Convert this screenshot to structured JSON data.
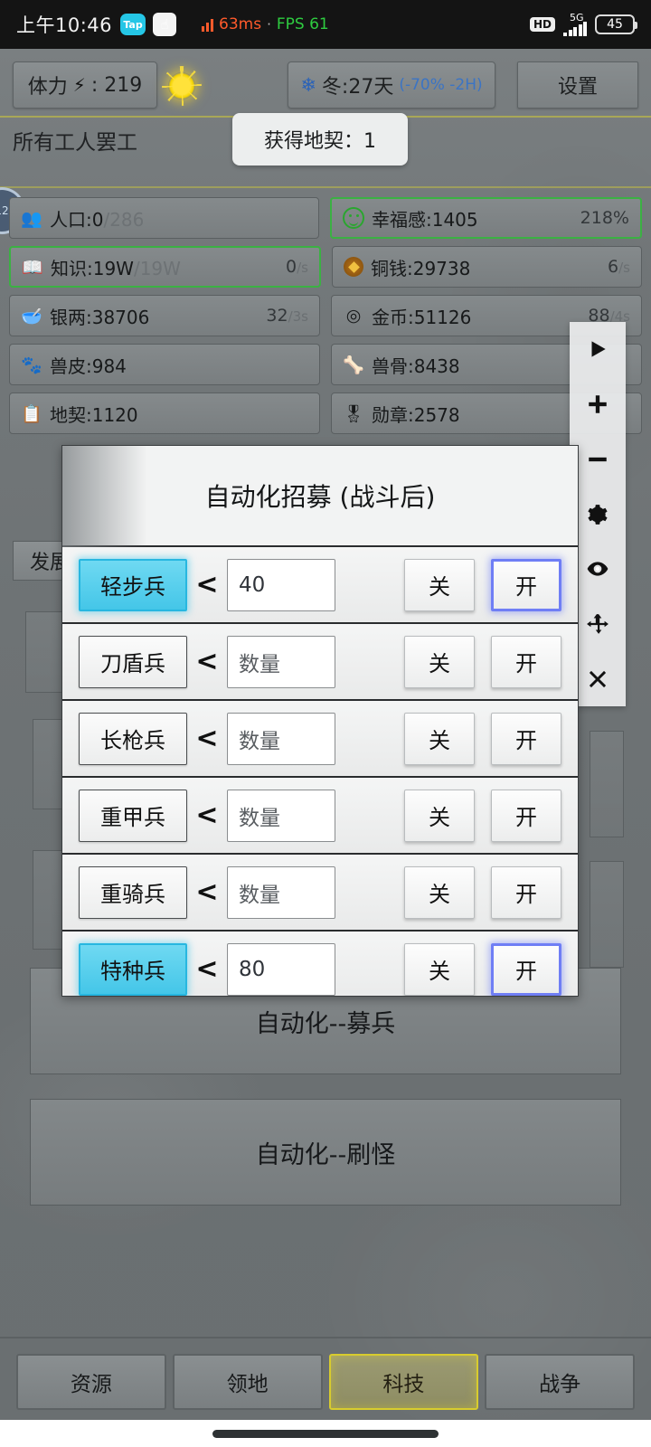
{
  "status_bar": {
    "time": "上午10:46",
    "tap_badge": "Tap",
    "app_badge": "☝",
    "ping": "63ms",
    "separator": "·",
    "fps": "FPS 61",
    "hd": "HD",
    "network": "5G",
    "battery": "45"
  },
  "header": {
    "stamina_label": "体力",
    "stamina_icon": "lightning-icon",
    "stamina_value": ": 219",
    "weather_icon": "sun-icon",
    "season_icon": "snowflake-icon",
    "season_text": "冬:27天",
    "season_modifier": "(-70% -2H)",
    "settings_label": "设置"
  },
  "notice": {
    "strike_text": "所有工人罢工",
    "toast_text": "获得地契：1"
  },
  "resources": [
    [
      {
        "icon": "people-icon",
        "label": "人口:",
        "value": "0",
        "max": "/286",
        "rate": "",
        "rate_unit": "",
        "highlight": false
      },
      {
        "icon": "happy-face-icon",
        "label": "幸福感:",
        "value": "1405",
        "max": "",
        "rate": "218%",
        "rate_unit": "",
        "highlight": true
      }
    ],
    [
      {
        "icon": "book-icon",
        "label": "知识:",
        "value": "19W",
        "max": "/19W",
        "rate": "0",
        "rate_unit": "/s",
        "highlight": true
      },
      {
        "icon": "copper-coin-icon",
        "label": "铜钱:",
        "value": "29738",
        "max": "",
        "rate": "6",
        "rate_unit": "/s",
        "highlight": false
      }
    ],
    [
      {
        "icon": "silver-ingot-icon",
        "label": "银两:",
        "value": "38706",
        "max": "",
        "rate": "32",
        "rate_unit": "/3s",
        "highlight": false
      },
      {
        "icon": "gold-coin-icon",
        "label": "金币:",
        "value": "51126",
        "max": "",
        "rate": "88",
        "rate_unit": "/4s",
        "highlight": false
      }
    ],
    [
      {
        "icon": "beast-hide-icon",
        "label": "兽皮:",
        "value": "984",
        "max": "",
        "rate": "",
        "rate_unit": "",
        "highlight": false
      },
      {
        "icon": "bone-icon",
        "label": "兽骨:",
        "value": "8438",
        "max": "",
        "rate": "",
        "rate_unit": "",
        "highlight": false
      }
    ],
    [
      {
        "icon": "deed-icon",
        "label": "地契:",
        "value": "1120",
        "max": "",
        "rate": "",
        "rate_unit": "",
        "highlight": false
      },
      {
        "icon": "medal-icon",
        "label": "勋章:",
        "value": "2578",
        "max": "",
        "rate": "",
        "rate_unit": "",
        "highlight": false
      }
    ]
  ],
  "float_toolbar": {
    "items": [
      {
        "icon": "play-icon"
      },
      {
        "icon": "plus-icon"
      },
      {
        "icon": "minus-icon"
      },
      {
        "icon": "gear-icon"
      },
      {
        "icon": "eye-icon"
      },
      {
        "icon": "move-icon"
      },
      {
        "icon": "close-icon"
      }
    ]
  },
  "background": {
    "develop_button": "发展"
  },
  "modal": {
    "title": "自动化招募 (战斗后)",
    "compare_symbol": "<",
    "quantity_placeholder": "数量",
    "off_label": "关",
    "on_label": "开",
    "rows": [
      {
        "unit": "轻步兵",
        "unit_active": true,
        "value": "40",
        "has_value": true,
        "state": "on"
      },
      {
        "unit": "刀盾兵",
        "unit_active": false,
        "value": "",
        "has_value": false,
        "state": "none"
      },
      {
        "unit": "长枪兵",
        "unit_active": false,
        "value": "",
        "has_value": false,
        "state": "none"
      },
      {
        "unit": "重甲兵",
        "unit_active": false,
        "value": "",
        "has_value": false,
        "state": "none"
      },
      {
        "unit": "重骑兵",
        "unit_active": false,
        "value": "",
        "has_value": false,
        "state": "none"
      },
      {
        "unit": "特种兵",
        "unit_active": true,
        "value": "80",
        "has_value": true,
        "state": "on"
      }
    ]
  },
  "big_buttons": [
    {
      "label": "自动化--募兵"
    },
    {
      "label": "自动化--刷怪"
    }
  ],
  "bottom_tabs": [
    {
      "label": "资源",
      "selected": false
    },
    {
      "label": "领地",
      "selected": false
    },
    {
      "label": "科技",
      "selected": true
    },
    {
      "label": "战争",
      "selected": false
    }
  ],
  "colors": {
    "accent_cyan": "#44c6e8",
    "accent_blue": "#6f7ef5",
    "accent_green": "#3bb143",
    "accent_yellow": "#d8cc2e",
    "bg_gray": "#6f7476"
  }
}
